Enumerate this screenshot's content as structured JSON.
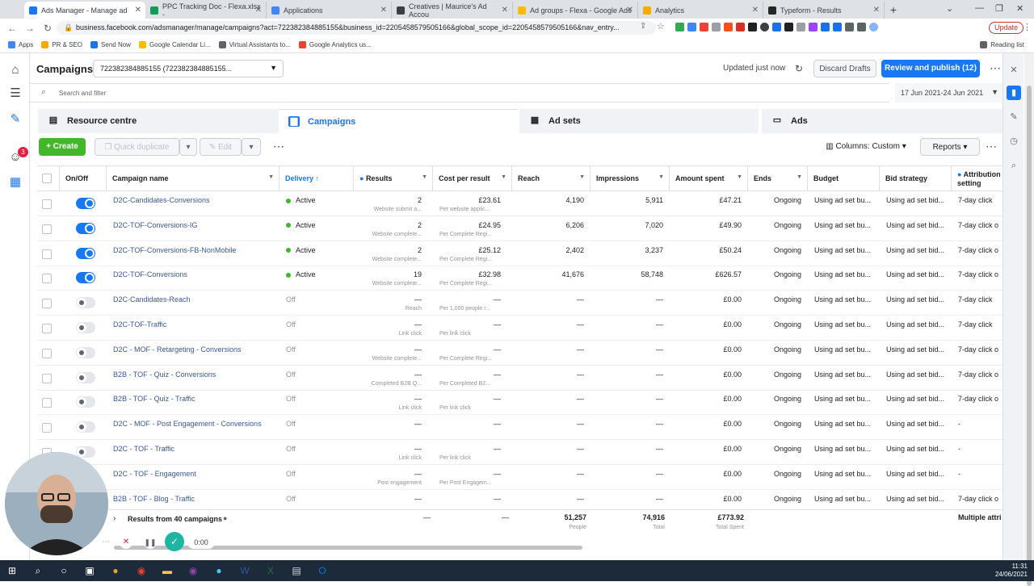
{
  "browser": {
    "tabs": [
      {
        "label": "Ads Manager - Manage ad",
        "color": "#1877f2",
        "active": true
      },
      {
        "label": "PPC Tracking Doc - Flexa.xlsx -",
        "color": "#0f9d58"
      },
      {
        "label": "Applications",
        "color": "#4285f4"
      },
      {
        "label": "Creatives | Maurice's Ad Accou",
        "color": "#3c4043"
      },
      {
        "label": "Ad groups - Flexa - Google Ads",
        "color": "#fbbc04"
      },
      {
        "label": "Analytics",
        "color": "#f9ab00"
      },
      {
        "label": "Typeform - Results",
        "color": "#262627"
      }
    ],
    "new_tab": "+",
    "url": "business.facebook.com/adsmanager/manage/campaigns?act=722382384885155&business_id=2205458579505166&global_scope_id=2205458579505166&nav_entry...",
    "update_label": "Update",
    "bookmarks": [
      {
        "label": "Apps",
        "color": "#4285f4"
      },
      {
        "label": "PR & SEO",
        "color": "#f9ab00"
      },
      {
        "label": "Send Now",
        "color": "#1a73e8"
      },
      {
        "label": "Google Calendar Li...",
        "color": "#fbbc04"
      },
      {
        "label": "Virtual Assistants to...",
        "color": "#5f6368"
      },
      {
        "label": "Google Analytics us...",
        "color": "#ea4335"
      }
    ],
    "reading_list": "Reading list"
  },
  "header": {
    "title": "Campaigns",
    "account": "722382384885155 (722382384885155...",
    "updated": "Updated just now",
    "discard": "Discard Drafts",
    "review": "Review and publish (12)"
  },
  "search": {
    "placeholder": "Search and filter"
  },
  "date_range": "17 Jun 2021-24 Jun 2021",
  "level_tabs": {
    "resource": "Resource centre",
    "campaigns": "Campaigns",
    "adsets": "Ad sets",
    "ads": "Ads"
  },
  "toolbar": {
    "create": "Create",
    "quick_duplicate": "Quick duplicate",
    "edit": "Edit",
    "columns": "Columns: Custom",
    "reports": "Reports"
  },
  "notification_badge": "3",
  "columns": {
    "onoff": "On/Off",
    "name": "Campaign name",
    "delivery": "Delivery ↑",
    "results": "Results",
    "cpr": "Cost per result",
    "reach": "Reach",
    "impressions": "Impressions",
    "spent": "Amount spent",
    "ends": "Ends",
    "budget": "Budget",
    "bid": "Bid strategy",
    "attribution": "Attribution setting"
  },
  "rows": [
    {
      "name": "D2C-Candidates-Conversions",
      "on": true,
      "delivery": "Active",
      "results": "2",
      "results_sub": "Website submit a...",
      "cpr": "£23.61",
      "cpr_sub": "Per website applic...",
      "reach": "4,190",
      "impressions": "5,911",
      "spent": "£47.21",
      "ends": "Ongoing",
      "budget": "Using ad set bu...",
      "bid": "Using ad set bid...",
      "attr": "7-day click"
    },
    {
      "name": "D2C-TOF-Conversions-IG",
      "on": true,
      "delivery": "Active",
      "results": "2",
      "results_sub": "Website complete...",
      "cpr": "£24.95",
      "cpr_sub": "Per Complete Regi...",
      "reach": "6,206",
      "impressions": "7,020",
      "spent": "£49.90",
      "ends": "Ongoing",
      "budget": "Using ad set bu...",
      "bid": "Using ad set bid...",
      "attr": "7-day click o"
    },
    {
      "name": "D2C-TOF-Conversions-FB-NonMobile",
      "on": true,
      "delivery": "Active",
      "results": "2",
      "results_sub": "Website complete...",
      "cpr": "£25.12",
      "cpr_sub": "Per Complete Regi...",
      "reach": "2,402",
      "impressions": "3,237",
      "spent": "£50.24",
      "ends": "Ongoing",
      "budget": "Using ad set bu...",
      "bid": "Using ad set bid...",
      "attr": "7-day click o"
    },
    {
      "name": "D2C-TOF-Conversions",
      "on": true,
      "delivery": "Active",
      "results": "19",
      "results_sub": "Website complete...",
      "cpr": "£32.98",
      "cpr_sub": "Per Complete Regi...",
      "reach": "41,676",
      "impressions": "58,748",
      "spent": "£626.57",
      "ends": "Ongoing",
      "budget": "Using ad set bu...",
      "bid": "Using ad set bid...",
      "attr": "7-day click o"
    },
    {
      "name": "D2C-Candidates-Reach",
      "on": false,
      "delivery": "Off",
      "results": "—",
      "results_sub": "Reach",
      "cpr": "—",
      "cpr_sub": "Per 1,000 people r...",
      "reach": "—",
      "impressions": "—",
      "spent": "£0.00",
      "ends": "Ongoing",
      "budget": "Using ad set bu...",
      "bid": "Using ad set bid...",
      "attr": "7-day click"
    },
    {
      "name": "D2C-TOF-Traffic",
      "on": false,
      "delivery": "Off",
      "results": "—",
      "results_sub": "Link click",
      "cpr": "—",
      "cpr_sub": "Per link click",
      "reach": "—",
      "impressions": "—",
      "spent": "£0.00",
      "ends": "Ongoing",
      "budget": "Using ad set bu...",
      "bid": "Using ad set bid...",
      "attr": "7-day click"
    },
    {
      "name": "D2C - MOF - Retargeting - Conversions",
      "on": false,
      "delivery": "Off",
      "results": "—",
      "results_sub": "Website complete...",
      "cpr": "—",
      "cpr_sub": "Per Complete Regi...",
      "reach": "—",
      "impressions": "—",
      "spent": "£0.00",
      "ends": "Ongoing",
      "budget": "Using ad set bu...",
      "bid": "Using ad set bid...",
      "attr": "7-day click o"
    },
    {
      "name": "B2B - TOF - Quiz - Conversions",
      "on": false,
      "delivery": "Off",
      "results": "—",
      "results_sub": "Completed B2B Q...",
      "cpr": "—",
      "cpr_sub": "Per Completed B2...",
      "reach": "—",
      "impressions": "—",
      "spent": "£0.00",
      "ends": "Ongoing",
      "budget": "Using ad set bu...",
      "bid": "Using ad set bid...",
      "attr": "7-day click o"
    },
    {
      "name": "B2B - TOF - Quiz - Traffic",
      "on": false,
      "delivery": "Off",
      "results": "—",
      "results_sub": "Link click",
      "cpr": "—",
      "cpr_sub": "Per link click",
      "reach": "—",
      "impressions": "—",
      "spent": "£0.00",
      "ends": "Ongoing",
      "budget": "Using ad set bu...",
      "bid": "Using ad set bid...",
      "attr": "7-day click o"
    },
    {
      "name": "D2C - MOF - Post Engagement - Conversions",
      "on": false,
      "delivery": "Off",
      "results": "—",
      "results_sub": "",
      "cpr": "—",
      "cpr_sub": "",
      "reach": "—",
      "impressions": "—",
      "spent": "£0.00",
      "ends": "Ongoing",
      "budget": "Using ad set bu...",
      "bid": "Using ad set bid...",
      "attr": "-"
    },
    {
      "name": "D2C - TOF - Traffic",
      "on": false,
      "delivery": "Off",
      "results": "—",
      "results_sub": "Link click",
      "cpr": "—",
      "cpr_sub": "Per link click",
      "reach": "—",
      "impressions": "—",
      "spent": "£0.00",
      "ends": "Ongoing",
      "budget": "Using ad set bu...",
      "bid": "Using ad set bid...",
      "attr": "-"
    },
    {
      "name": "D2C - TOF - Engagement",
      "on": false,
      "delivery": "Off",
      "results": "—",
      "results_sub": "Post engagement",
      "cpr": "—",
      "cpr_sub": "Per Post Engagem...",
      "reach": "—",
      "impressions": "—",
      "spent": "£0.00",
      "ends": "Ongoing",
      "budget": "Using ad set bu...",
      "bid": "Using ad set bid...",
      "attr": "-"
    },
    {
      "name": "B2B - TOF - Blog - Traffic",
      "on": false,
      "delivery": "Off",
      "results": "—",
      "results_sub": "",
      "cpr": "—",
      "cpr_sub": "",
      "reach": "—",
      "impressions": "—",
      "spent": "£0.00",
      "ends": "Ongoing",
      "budget": "Using ad set bu...",
      "bid": "Using ad set bid...",
      "attr": "7-day click o"
    }
  ],
  "totals": {
    "label": "Results from 40 campaigns",
    "results": "—",
    "cpr": "—",
    "reach": "51,257",
    "reach_sub": "People",
    "impressions": "74,916",
    "impressions_sub": "Total",
    "spent": "£773.92",
    "spent_sub": "Total Spent",
    "attr": "Multiple attri"
  },
  "player": {
    "time": "0:00"
  },
  "clock": {
    "time": "11:31",
    "date": "24/06/2021"
  }
}
